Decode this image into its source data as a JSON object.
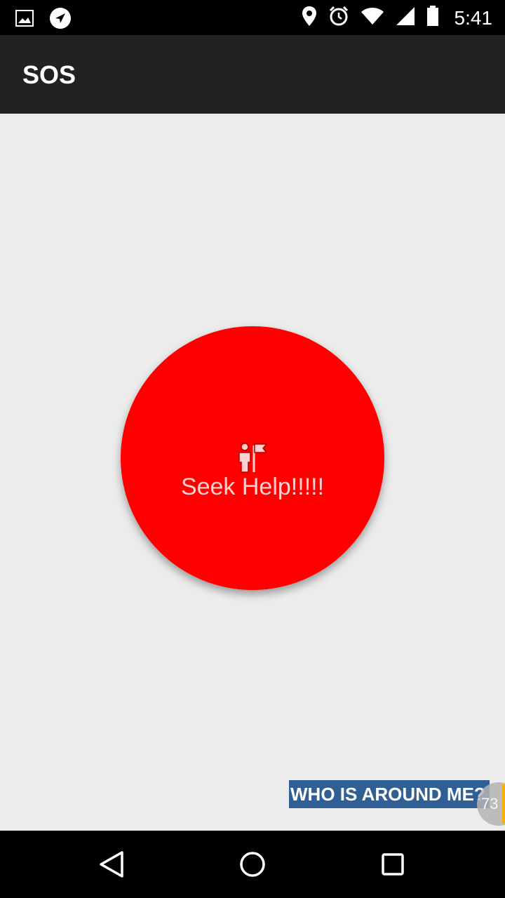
{
  "status_bar": {
    "time": "5:41",
    "left_icons": [
      "gallery-icon",
      "navigation-icon"
    ],
    "right_icons": [
      "location-icon",
      "alarm-icon",
      "wifi-icon",
      "signal-icon",
      "battery-icon"
    ]
  },
  "app_bar": {
    "title": "SOS"
  },
  "main": {
    "sos_button": {
      "label": "Seek Help!!!!!",
      "icon": "person-flag-icon",
      "color": "#ff0000"
    },
    "who_button": {
      "label": "WHO IS AROUND ME?",
      "color": "#2f5f95"
    },
    "badge": {
      "value": "73"
    }
  },
  "nav_bar": {
    "buttons": [
      "back",
      "home",
      "recents"
    ]
  }
}
